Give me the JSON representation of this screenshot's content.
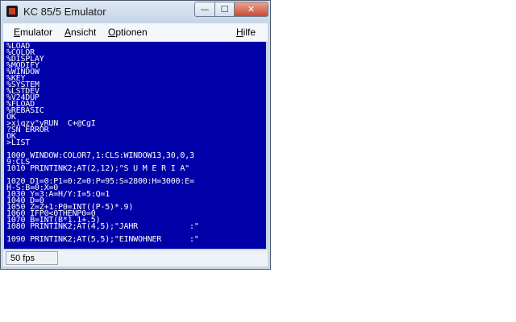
{
  "window": {
    "title": "KC 85/5 Emulator"
  },
  "caption_buttons": {
    "minimize": "—",
    "maximize": "☐",
    "close": "✕"
  },
  "menu": [
    {
      "pre": "",
      "u": "E",
      "post": "mulator"
    },
    {
      "pre": "",
      "u": "A",
      "post": "nsicht"
    },
    {
      "pre": "",
      "u": "O",
      "post": "ptionen"
    },
    {
      "pre": "",
      "u": "H",
      "post": "ilfe"
    }
  ],
  "screen": {
    "lines": [
      "%LOAD",
      "%COLOR",
      "%DISPLAY",
      "%MODIFY",
      "%WINDOW",
      "%KEY",
      "%SYSTEM",
      "%LSTDEV",
      "%V24DUP",
      "%FLOAD",
      "%REBASIC",
      "OK",
      ">xiqzy\"yRUN  C+@CgI",
      "?SN ERROR",
      "OK",
      ">LIST",
      "",
      "1000 WINDOW:COLOR7,1:CLS:WINDOW13,30,0,3",
      "9:CLS",
      "1010 PRINTINK2;AT(2,12);\"S U M E R I A\"",
      "",
      "1020 D1=0:P1=0:Z=0:P=95:S=2800:H=3000:E=",
      "H-S:B=0:X=0",
      "1030 Y=3:A=H/Y:I=5:Q=1",
      "1040 D=0",
      "1050 Z=Z+1:P0=INT((P-5)*.9)",
      "1060 IFP0<0THENP0=0",
      "1070 B=INT(B*1.1+.5)",
      "1080 PRINTINK2;AT(4,5);\"JAHR           :\"",
      "",
      "1090 PRINTINK2;AT(5,5);\"EINWOHNER      :\""
    ]
  },
  "status": {
    "fps": "50 fps"
  }
}
